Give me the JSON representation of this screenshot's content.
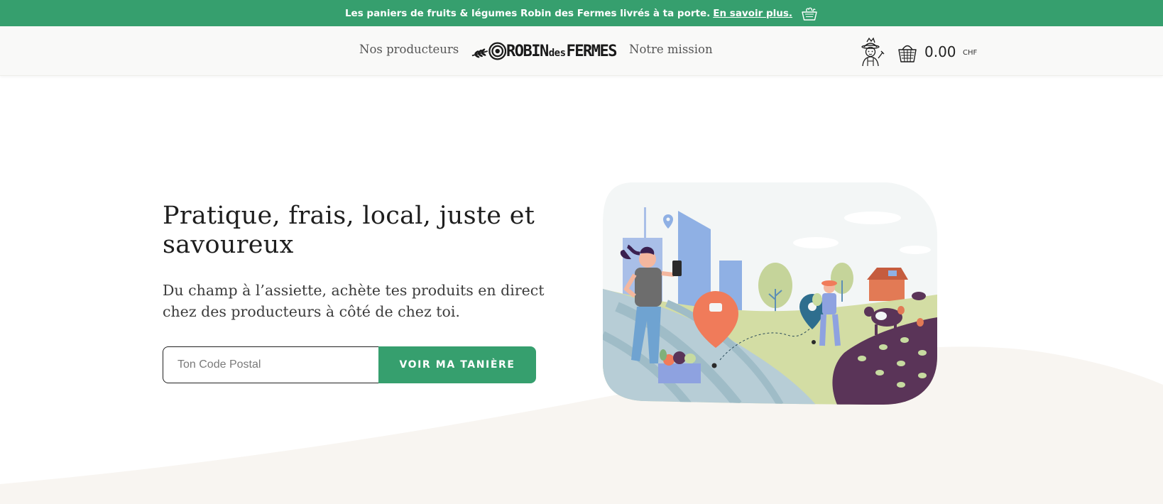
{
  "announcement": {
    "text": "Les paniers de fruits & légumes Robin des Fermes livrés à ta porte.",
    "link_label": "En savoir plus.",
    "icon": "basket-icon"
  },
  "nav": {
    "left_link": "Nos producteurs",
    "right_link": "Notre mission",
    "logo": {
      "part1": "ROBIN",
      "part2": "des",
      "part3": "FERMES"
    },
    "account_icon": "farmer-icon",
    "cart_icon": "basket-icon",
    "cart_amount": "0.00",
    "cart_currency": "CHF"
  },
  "hero": {
    "title": "Pratique, frais, local, juste et savoureux",
    "subtitle": "Du champ à l’assiette, achète tes produits en direct chez des producteurs à côté de chez toi.",
    "postal_placeholder": "Ton Code Postal",
    "postal_value": "",
    "cta_label": "VOIR MA TANIÈRE",
    "illustration": "city-to-farm-illustration"
  },
  "colors": {
    "brand_green": "#369f6e",
    "nav_bg": "#f9f9f8",
    "wave_beige": "#f8f5f1",
    "pin_orange": "#f07b5a",
    "pin_blue": "#2e6e8e",
    "city_blue": "#8fb0e4",
    "field_purple": "#5a3458"
  }
}
